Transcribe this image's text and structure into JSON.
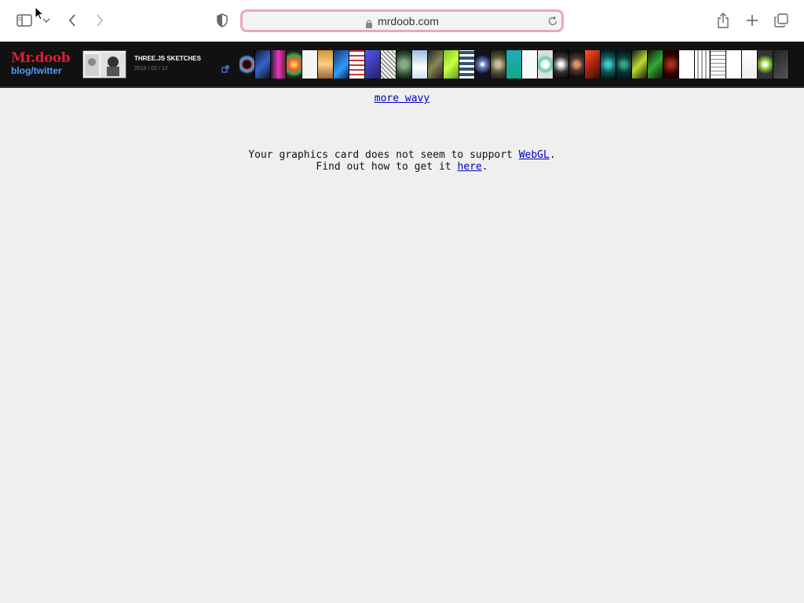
{
  "browser": {
    "url": "mrdoob.com"
  },
  "header": {
    "logo_main": "Mr.doob",
    "logo_sub": "blog/twitter",
    "featured_title": "THREE.JS SKETCHES",
    "featured_date": "2016 / 02 / 12"
  },
  "page": {
    "more_link": "more wavy",
    "msg_line1_before": "Your graphics card does not seem to support ",
    "msg_line1_link": "WebGL",
    "msg_line1_after": ".",
    "msg_line2_before": "Find out how to get it ",
    "msg_line2_link": "here",
    "msg_line2_after": "."
  },
  "icons": {
    "sidebar": "sidebar-icon",
    "back": "chevron-left-icon",
    "forward": "chevron-right-icon",
    "privacy": "shield-icon",
    "share": "share-icon",
    "new_tab": "plus-icon",
    "tabs": "tabs-overview-icon"
  },
  "colors": {
    "url_focus": "#e7a7c6",
    "logo_red": "#e31b3a",
    "logo_blue": "#4aa0ff",
    "link": "#0000bb"
  }
}
